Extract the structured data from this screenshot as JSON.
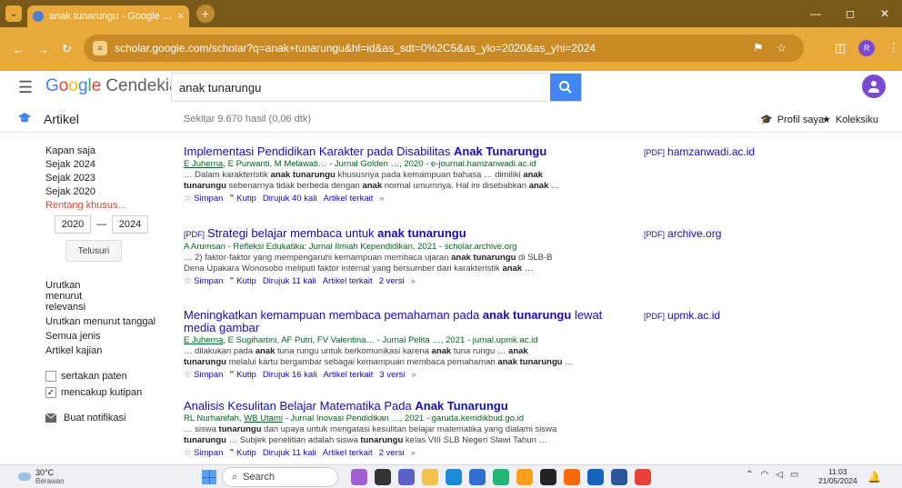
{
  "browser": {
    "tab_title": "anak tunarungu - Google Scho",
    "tab_close": "×",
    "new_tab": "+",
    "url": "scholar.google.com/scholar?q=anak+tunarungu&hl=id&as_sdt=0%2C5&as_ylo=2020&as_yhi=2024",
    "profile_letter": "R",
    "window_controls": [
      "—",
      "◻",
      "✕"
    ]
  },
  "header": {
    "logo_parts": [
      "G",
      "o",
      "o",
      "g",
      "l",
      "e"
    ],
    "logo_suffix": "Cendekia",
    "search_value": "anak tunarungu"
  },
  "subbar": {
    "section": "Artikel",
    "result_count": "Sekitar 9.670 hasil (0,06 dtk)",
    "profile": "Profil saya",
    "library": "Koleksiku"
  },
  "sidebar": {
    "time_filters": [
      "Kapan saja",
      "Sejak 2024",
      "Sejak 2023",
      "Sejak 2020"
    ],
    "custom_range": "Rentang khusus...",
    "year_from": "2020",
    "year_to": "2024",
    "search_button": "Telusuri",
    "sort_relevance": "Urutkan menurut relevansi",
    "sort_date": "Urutkan menurut tanggal",
    "all_types": "Semua jenis",
    "review_articles": "Artikel kajian",
    "include_patents": "sertakan paten",
    "include_citations": "mencakup kutipan",
    "create_alert": "Buat notifikasi"
  },
  "results": [
    {
      "tag": "",
      "title_html": "Implementasi Pendidikan Karakter pada Disabilitas <b>Anak Tunarungu</b>",
      "meta_html": "<u>E Juherna</u>, E Purwanti, M Melawati… - Jurnal Golden …, 2020 - e-journal.hamzanwadi.ac.id",
      "snippet_html": "… Dalam karakteristik <b>anak tunarungu</b> khususnya pada kemampuan bahasa … dimiliki <b>anak</b><br><b>tunarungu</b> sebenarnya tidak berbeda dengan <b>anak</b> normal umumnya. Hal ini disebabkan <b>anak</b> …",
      "save": "Simpan",
      "cite": "Kutip",
      "cited_by": "Dirujuk 40 kali",
      "related": "Artikel terkait",
      "versions": "",
      "pdf_label": "[PDF]",
      "pdf_source": "hamzanwadi.ac.id"
    },
    {
      "tag": "[PDF]",
      "title_html": "Strategi belajar membaca untuk <b>anak tunarungu</b>",
      "meta_html": "A Arumsari - Refleksi Edukatika: Jurnal Ilmiah Kependidikan, 2021 - scholar.archive.org",
      "snippet_html": "… 2) faktor-faktor yang mempengaruhi kemampuan membaca ujaran <b>anak tunarungu</b> di SLB-B<br>Dena Upakara Wonosobo meliputi faktor internal yang bersumber dari karakteristik <b>anak</b> …",
      "save": "Simpan",
      "cite": "Kutip",
      "cited_by": "Dirujuk 11 kali",
      "related": "Artikel terkait",
      "versions": "2 versi",
      "pdf_label": "[PDF]",
      "pdf_source": "archive.org"
    },
    {
      "tag": "",
      "title_html": "Meningkatkan kemampuan membaca pemahaman pada <b>anak tunarungu</b> lewat<br>media gambar",
      "meta_html": "<u>E Juherna</u>, E Sugihartini, AF Putri, FV Valentina… - Jurnal Pelita …, 2021 - jurnal.upmk.ac.id",
      "snippet_html": "… dilakukan pada <b>anak</b> tuna rungu untuk berkomunikasi karena <b>anak</b> tuna rungu … <b>anak</b><br><b>tunarungu</b> melalui kartu bergambar sebagai kemampuan membaca pemahaman <b>anak tunarungu</b> …",
      "save": "Simpan",
      "cite": "Kutip",
      "cited_by": "Dirujuk 16 kali",
      "related": "Artikel terkait",
      "versions": "3 versi",
      "pdf_label": "[PDF]",
      "pdf_source": "upmk.ac.id"
    },
    {
      "tag": "",
      "title_html": "Analisis Kesulitan Belajar Matematika Pada <b>Anak Tunarungu</b>",
      "meta_html": "RL Nurhanifah, <u>WB Utami</u> - Jurnal Inovasi Pendidikan …, 2021 - garuda.kemdikbud.go.id",
      "snippet_html": "… siswa <b>tunarungu</b> dan upaya untuk mengatasi kesulitan belajar matematika yang dialami siswa<br><b>tunarungu</b> … Subjek penelitian adalah siswa <b>tunarungu</b> kelas VIII SLB Negeri Slawi Tahun …",
      "save": "Simpan",
      "cite": "Kutip",
      "cited_by": "Dirujuk 11 kali",
      "related": "Artikel terkait",
      "versions": "2 versi",
      "pdf_label": "",
      "pdf_source": ""
    }
  ],
  "taskbar": {
    "temperature": "30°C",
    "weather": "Berawan",
    "search_label": "Search",
    "time": "11:03",
    "date": "21/05/2024"
  },
  "colors": {
    "chrome_dark": "#7a5a18",
    "chrome_light": "#e8a93a",
    "link": "#1a0dab",
    "meta_green": "#006621",
    "red": "#d14836",
    "button_blue": "#4285f4"
  }
}
